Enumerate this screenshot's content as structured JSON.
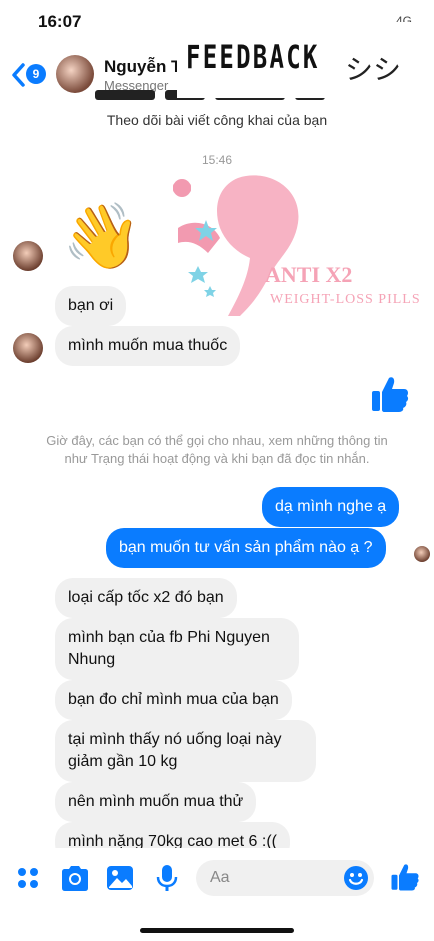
{
  "status": {
    "time": "16:07",
    "right": "4G"
  },
  "header": {
    "back_badge": "9",
    "name": "Nguyễn T",
    "subtitle": "Messenger",
    "overlay_title": "FEEDBACK",
    "overlay_suffix": "シシ"
  },
  "thread": {
    "info_line": "Theo dõi bài viết công khai của bạn",
    "time_separator": "15:46",
    "emoji": "👋",
    "notice": "Giờ đây, các bạn có thể gọi cho nhau, xem những thông tin như Trạng thái hoạt động và khi bạn đã đọc tin nhắn.",
    "messages_a": [
      {
        "text": "bạn ơi"
      },
      {
        "text": "mình muốn mua thuốc"
      }
    ],
    "outgoing": [
      {
        "text": "dạ mình nghe ạ"
      },
      {
        "text": "bạn muốn tư vấn sản phẩm nào ạ ?"
      }
    ],
    "messages_b": [
      {
        "text": "loại cấp tốc x2 đó bạn"
      },
      {
        "text": "mình bạn của fb Phi Nguyen Nhung"
      },
      {
        "text": "bạn đo chỉ mình mua của bạn"
      },
      {
        "text": "tại mình thấy nó uống loại này giảm gần 10 kg"
      },
      {
        "text": "nên mình muốn mua thử"
      },
      {
        "text": "mình nặng 70kg cao met 6 :(("
      }
    ]
  },
  "watermark": {
    "brand": "ANTI X2",
    "tagline": "WEIGHT-LOSS PILLS"
  },
  "composer": {
    "placeholder": "Aa"
  },
  "colors": {
    "accent": "#0a7cff",
    "incoming_bubble": "#f0f0f0",
    "watermark": "#f5a3b6"
  }
}
